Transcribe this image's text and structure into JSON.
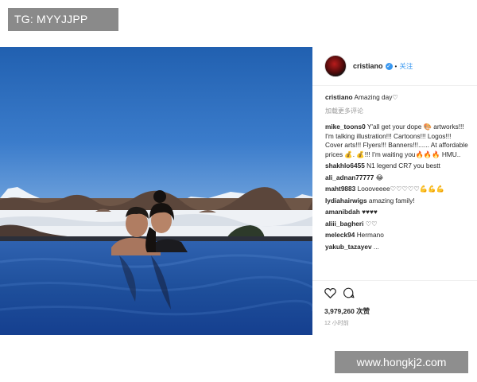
{
  "top_banner": "TG: MYYJJPP",
  "watermark": "www.hongkj2.com",
  "post": {
    "username": "cristiano",
    "dot": "•",
    "follow": "关注",
    "caption_user": "cristiano",
    "caption_text": "Amazing day♡",
    "load_more": "加载更多评论",
    "comments": [
      {
        "user": "mike_toons0",
        "text": "Y'all get your dope 🎨 artworks!!! I'm talking illustration!!! Cartoons!!! Logos!!! Cover arts!!! Flyers!!! Banners!!!...... At affordable prices 💰. 💰!!! I'm waiting you🔥🔥🔥 HMU.."
      },
      {
        "user": "shakhlo6455",
        "text": "N1 legend CR7 you bestt"
      },
      {
        "user": "ali_adnan77777",
        "text": "😂"
      },
      {
        "user": "maht9883",
        "text": "Loooveeee♡♡♡♡♡💪💪💪"
      },
      {
        "user": "lydiahairwigs",
        "text": "amazing family!"
      },
      {
        "user": "amanibdah",
        "text": "♥♥♥♥"
      },
      {
        "user": "aliii_bagheri",
        "text": "♡♡"
      },
      {
        "user": "meleck94",
        "text": "Hermano"
      },
      {
        "user": "yakub_tazayev",
        "text": "..."
      }
    ],
    "likes": "3,979,260 次赞",
    "time": "12 小时前"
  },
  "icons": [
    "verified-badge-icon",
    "heart-icon",
    "comment-icon"
  ],
  "colors": {
    "link": "#3897f0",
    "sky": "#2d69b5",
    "water": "#153f8f"
  }
}
